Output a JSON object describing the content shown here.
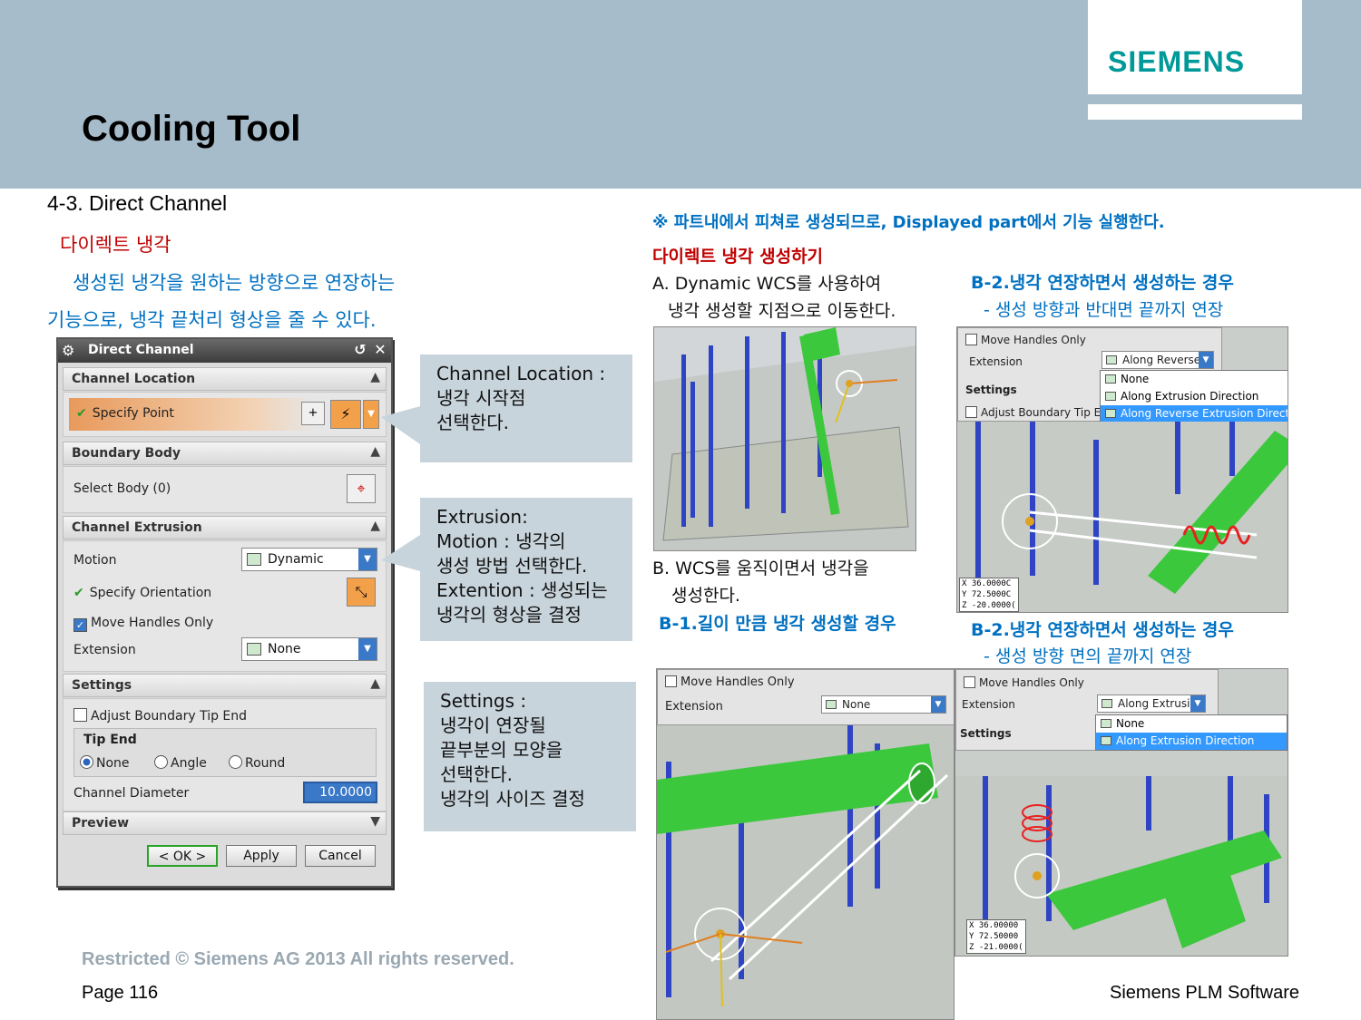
{
  "header": {
    "title": "Cooling Tool",
    "logo": "SIEMENS"
  },
  "left": {
    "section": "4-3. Direct Channel",
    "heading": "다이렉트 냉각",
    "desc_line1": "생성된 냉각을 원하는 방향으로 연장하는",
    "desc_line2": "기능으로, 냉각 끝처리 형상을 줄 수 있다."
  },
  "dialog": {
    "title": "Direct Channel",
    "channel_location": {
      "header": "Channel Location",
      "specify_point": "Specify Point"
    },
    "boundary_body": {
      "header": "Boundary Body",
      "select_body": "Select Body (0)"
    },
    "channel_extrusion": {
      "header": "Channel Extrusion",
      "motion_label": "Motion",
      "motion_value": "Dynamic",
      "specify_orientation": "Specify Orientation",
      "move_handles_only": "Move Handles Only",
      "extension_label": "Extension",
      "extension_value": "None"
    },
    "settings": {
      "header": "Settings",
      "adjust_boundary": "Adjust Boundary Tip End",
      "tip_end": "Tip End",
      "opt_none": "None",
      "opt_angle": "Angle",
      "opt_round": "Round",
      "diameter_label": "Channel Diameter",
      "diameter_value": "10.0000"
    },
    "preview": {
      "header": "Preview"
    },
    "buttons": {
      "ok": "< OK >",
      "apply": "Apply",
      "cancel": "Cancel"
    }
  },
  "callouts": {
    "location": [
      "Channel Location :",
      "냉각 시작점",
      "선택한다."
    ],
    "extrusion": [
      "Extrusion:",
      "Motion : 냉각의",
      "생성 방법 선택한다.",
      "Extention : 생성되는",
      "냉각의 형상을 결정"
    ],
    "settings": [
      "Settings :",
      "냉각이 연장될",
      "끝부분의 모양을",
      "선택한다.",
      "냉각의 사이즈 결정"
    ]
  },
  "right": {
    "note": "※ 파트내에서 피쳐로 생성되므로, Displayed part에서 기능 실행한다.",
    "create_heading": "다이렉트 냉각 생성하기",
    "step_a_1": "A.   Dynamic WCS를 사용하여",
    "step_a_2": "냉각 생성할 지점으로 이동한다.",
    "step_b_1": "B.   WCS를 움직이면서 냉각을",
    "step_b_2": "생성한다.",
    "b1_heading": "B-1.길이 만큼 냉각 생성할 경우",
    "b2_heading_a": "B-2.냉각 연장하면서 생성하는 경우",
    "b2_sub_a": "- 생성 방향과 반대면 끝까지 연장",
    "b2_heading_b": "B-2.냉각 연장하면서 생성하는 경우",
    "b2_sub_b": "- 생성 방향 면의 끝까지 연장"
  },
  "shot_b2a": {
    "move_handles": "Move Handles Only",
    "extension": "Extension",
    "ext_value": "Along Reverse",
    "settings": "Settings",
    "adjust": "Adjust Boundary Tip En",
    "menu": [
      "None",
      "Along Extrusion Direction",
      "Along Reverse Extrusion Direction"
    ],
    "coords": [
      "X 36.0000C",
      "Y 72.5000C",
      "Z -20.0000("
    ]
  },
  "shot_b1": {
    "move_handles": "Move Handles Only",
    "extension": "Extension",
    "ext_value": "None"
  },
  "shot_b2b": {
    "move_handles": "Move Handles Only",
    "extension": "Extension",
    "ext_value": "Along Extrusio",
    "settings": "Settings",
    "menu": [
      "None",
      "Along Extrusion Direction"
    ],
    "coords": [
      "X 36.00000",
      "Y 72.50000",
      "Z -21.0000("
    ]
  },
  "footer": {
    "copyright": "Restricted © Siemens AG 2013 All rights reserved.",
    "page": "Page 116",
    "brand": "Siemens PLM Software"
  },
  "colors": {
    "header_band": "#a7bcca",
    "logo_teal": "#009999",
    "red_text": "#c00000",
    "blue_text": "#0070c0",
    "callout_bg": "#c8d4dc"
  }
}
